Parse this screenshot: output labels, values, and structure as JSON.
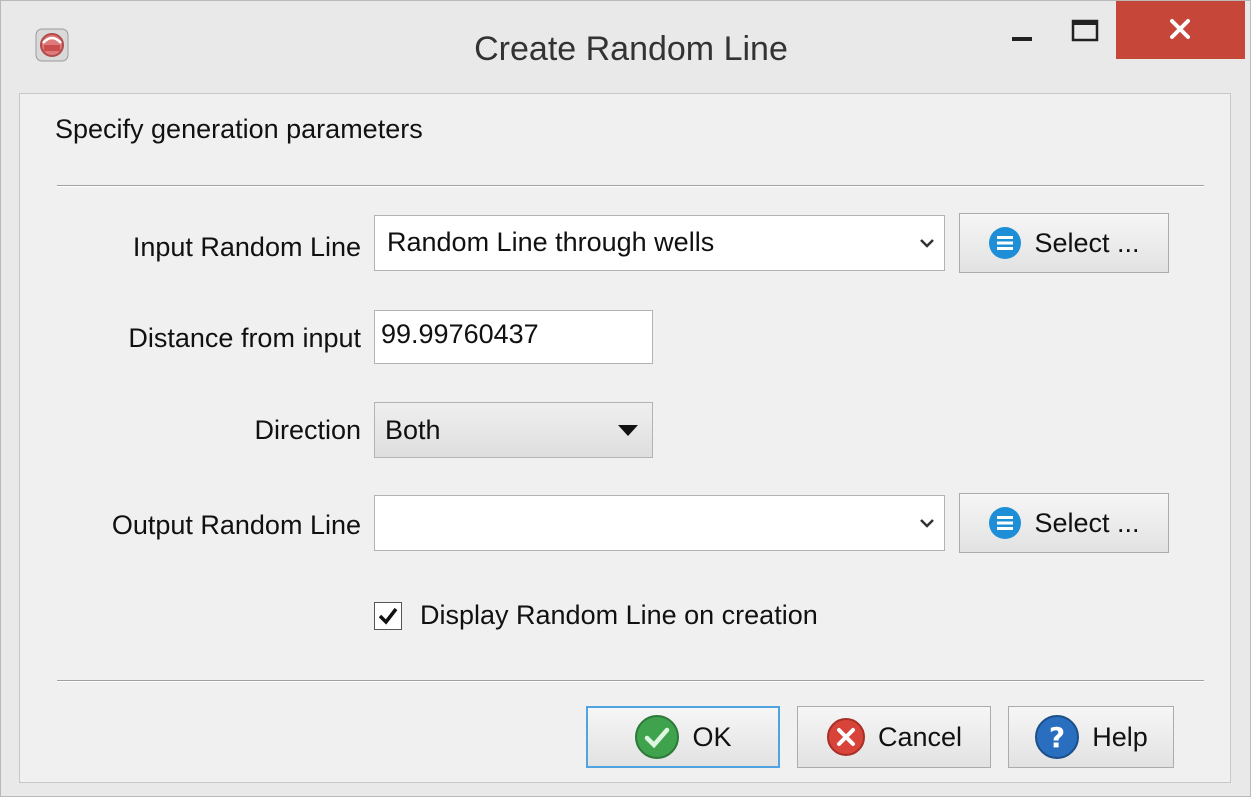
{
  "window": {
    "title": "Create Random Line",
    "minimize_icon": "minimize-icon",
    "maximize_icon": "maximize-icon",
    "close_icon": "close-icon",
    "close_color": "#c7463a"
  },
  "header": {
    "text": "Specify generation parameters"
  },
  "form": {
    "input_random_line": {
      "label": "Input Random Line",
      "value": "Random Line through wells",
      "select_label": "Select ..."
    },
    "distance": {
      "label": "Distance from input",
      "value": "99.99760437"
    },
    "direction": {
      "label": "Direction",
      "value": "Both"
    },
    "output_random_line": {
      "label": "Output Random Line",
      "value": "",
      "select_label": "Select ..."
    },
    "display_checkbox": {
      "label": "Display Random Line on creation",
      "checked": true
    }
  },
  "buttons": {
    "ok": "OK",
    "cancel": "Cancel",
    "help": "Help"
  },
  "colors": {
    "accent_blue": "#1e8fd6",
    "ok_green": "#3fa34d",
    "cancel_red": "#d9443a",
    "help_blue": "#2a6fbf"
  }
}
